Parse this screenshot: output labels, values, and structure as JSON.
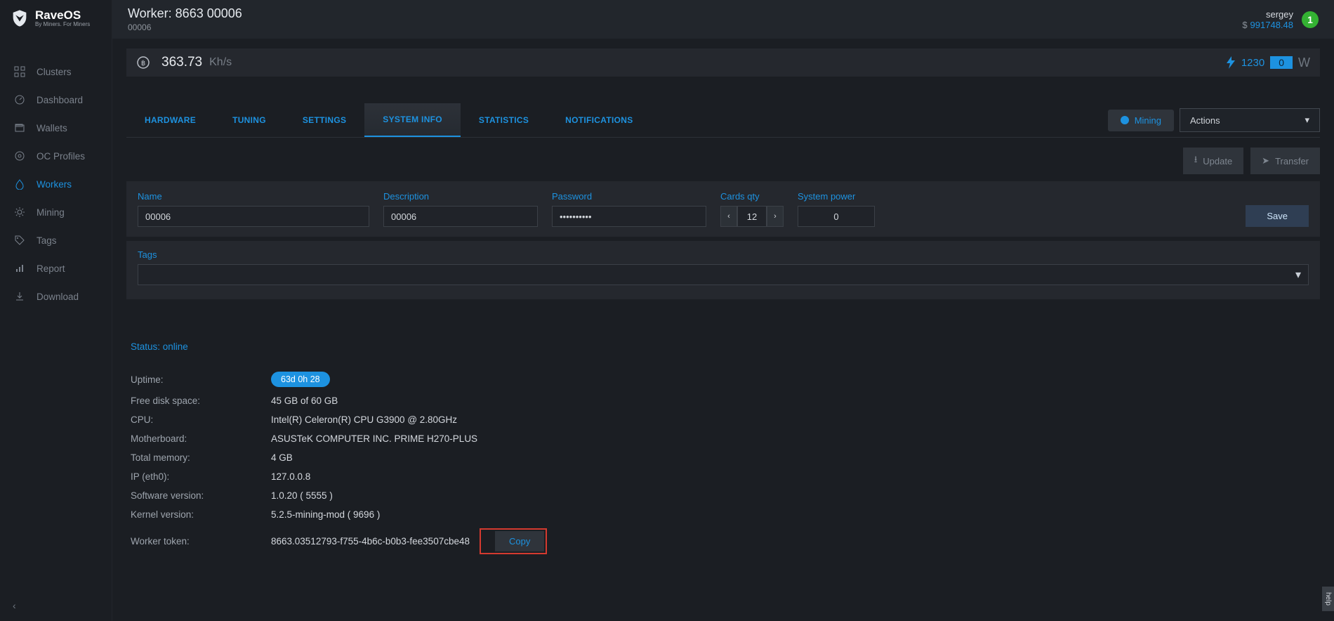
{
  "brand": {
    "name": "RaveOS",
    "tagline": "By Miners. For Miners"
  },
  "sidebar": {
    "items": [
      {
        "label": "Clusters"
      },
      {
        "label": "Dashboard"
      },
      {
        "label": "Wallets"
      },
      {
        "label": "OC Profiles"
      },
      {
        "label": "Workers"
      },
      {
        "label": "Mining"
      },
      {
        "label": "Tags"
      },
      {
        "label": "Report"
      },
      {
        "label": "Download"
      }
    ]
  },
  "header": {
    "title": "Worker: 8663 00006",
    "subtitle": "00006",
    "user": "sergey",
    "balance_symbol": "$",
    "balance": "991748.48",
    "notif_count": "1"
  },
  "hashbar": {
    "rate": "363.73",
    "unit": "Kh/s",
    "power_reading": "1230",
    "power_extra": "0",
    "power_unit": "W"
  },
  "tabs": [
    "HARDWARE",
    "TUNING",
    "SETTINGS",
    "SYSTEM INFO",
    "STATISTICS",
    "NOTIFICATIONS"
  ],
  "mining_label": "Mining",
  "actions_label": "Actions",
  "toolbar": {
    "update": "Update",
    "transfer": "Transfer"
  },
  "form": {
    "name_label": "Name",
    "name_value": "00006",
    "desc_label": "Description",
    "desc_value": "00006",
    "pass_label": "Password",
    "pass_value": "••••••••••",
    "cards_label": "Cards qty",
    "cards_value": "12",
    "power_label": "System power",
    "power_value": "0",
    "save_label": "Save",
    "tags_label": "Tags"
  },
  "info": {
    "status_label": "Status: online",
    "uptime_key": "Uptime:",
    "uptime_val": "63d 0h 28",
    "disk_key": "Free disk space:",
    "disk_val": "45 GB of 60 GB",
    "cpu_key": "CPU:",
    "cpu_val": "Intel(R) Celeron(R) CPU G3900 @ 2.80GHz",
    "mobo_key": "Motherboard:",
    "mobo_val": "ASUSTeK COMPUTER INC. PRIME H270-PLUS",
    "mem_key": "Total memory:",
    "mem_val": "4 GB",
    "ip_key": "IP (eth0):",
    "ip_val": "127.0.0.8",
    "sw_key": "Software version:",
    "sw_val": "1.0.20 ( 5555 )",
    "kernel_key": "Kernel version:",
    "kernel_val": "5.2.5-mining-mod ( 9696 )",
    "token_key": "Worker token:",
    "token_val": "8663.03512793-f755-4b6c-b0b3-fee3507cbe48",
    "copy_label": "Copy"
  },
  "help_label": "help"
}
